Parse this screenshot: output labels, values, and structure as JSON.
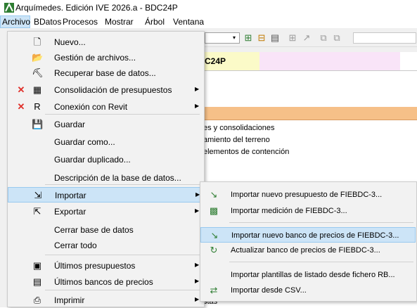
{
  "window": {
    "title": "Arquímedes. Edición IVE 2026.a - BDC24P"
  },
  "menubar": [
    "Archivo",
    "BDatos",
    "Procesos",
    "Mostrar",
    "Árbol",
    "Ventana"
  ],
  "toolbar": {
    "combo_arrow": "▾"
  },
  "background": {
    "tab_label": "C24P",
    "lines": [
      "es y consolidaciones",
      "amiento del terreno",
      "elementos de contención",
      "stas"
    ]
  },
  "archivo_menu": [
    {
      "label": "Nuevo...",
      "icon": "new-doc-icon",
      "glyph": "🗋"
    },
    {
      "label": "Gestión de archivos...",
      "icon": "folder-icon",
      "glyph": "📂"
    },
    {
      "label": "Recuperar base de datos...",
      "icon": "recover-icon",
      "glyph": "⛏"
    },
    {
      "label": "Consolidación de presupuestos",
      "icon": "consolidation-icon",
      "glyph": "▦",
      "x": true,
      "submenu": true
    },
    {
      "label": "Conexión con Revit",
      "icon": "revit-icon",
      "glyph": "R",
      "x": true,
      "submenu": true
    },
    {
      "label": "Guardar",
      "icon": "save-icon",
      "glyph": "💾"
    },
    {
      "label": "Guardar como..."
    },
    {
      "label": "Guardar duplicado..."
    },
    {
      "label": "Descripción de la base de datos..."
    },
    {
      "label": "Importar",
      "icon": "import-icon",
      "glyph": "⇲",
      "submenu": true,
      "highlight": true
    },
    {
      "label": "Exportar",
      "icon": "export-icon",
      "glyph": "⇱",
      "submenu": true
    },
    {
      "label": "Cerrar base de datos"
    },
    {
      "label": "Cerrar todo"
    },
    {
      "label": "Últimos presupuestos",
      "icon": "recent-budgets-icon",
      "glyph": "▣",
      "submenu": true
    },
    {
      "label": "Últimos bancos de precios",
      "icon": "recent-banks-icon",
      "glyph": "▤",
      "submenu": true
    },
    {
      "label": "Imprimir",
      "icon": "print-icon",
      "glyph": "⎙",
      "submenu": true
    }
  ],
  "importar_submenu": [
    {
      "label": "Importar nuevo presupuesto de FIEBDC-3...",
      "icon": "import-budget-icon",
      "glyph": "↘"
    },
    {
      "label": "Importar medición de FIEBDC-3...",
      "icon": "import-measure-icon",
      "glyph": "▩"
    },
    {
      "label": "Importar nuevo banco de precios de FIEBDC-3...",
      "icon": "import-bank-icon",
      "glyph": "↘",
      "highlight": true
    },
    {
      "label": "Actualizar banco de precios de FIEBDC-3...",
      "icon": "update-bank-icon",
      "glyph": "↻"
    },
    {
      "label": "Importar plantillas de listado desde fichero RB..."
    },
    {
      "label": "Importar desde CSV...",
      "icon": "csv-icon",
      "glyph": "⇄"
    }
  ]
}
